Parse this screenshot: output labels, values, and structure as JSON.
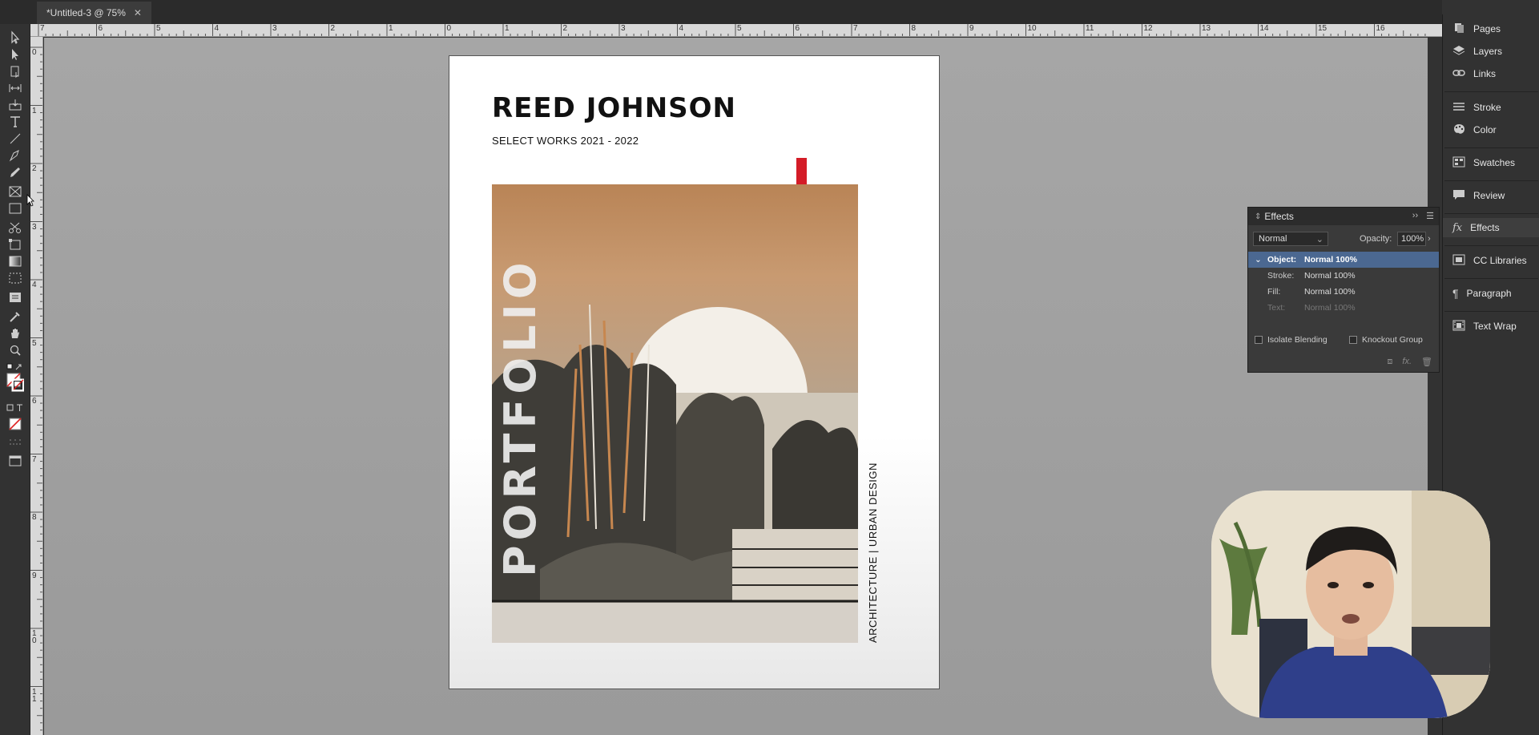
{
  "document_tab": {
    "title": "*Untitled-3 @ 75%",
    "close_glyph": "✕"
  },
  "ruler": {
    "horizontal_ticks": [
      "7",
      "6",
      "5",
      "4",
      "3",
      "2",
      "1",
      "0",
      "1",
      "2",
      "3",
      "4",
      "5",
      "6",
      "7",
      "8",
      "9",
      "10",
      "11",
      "12",
      "13",
      "14",
      "15",
      "16"
    ],
    "vertical_ticks": [
      "0",
      "1",
      "2",
      "3",
      "4",
      "5",
      "6",
      "7",
      "8",
      "9",
      "1\n0",
      "1\n1"
    ]
  },
  "page": {
    "title": "REED JOHNSON",
    "subtitle": "SELECT WORKS 2021 - 2022",
    "cover_word": "PORTFOLIO",
    "side_caption": "ARCHITECTURE | URBAN DESIGN",
    "accent_color": "#d41c27"
  },
  "dock": {
    "items": [
      {
        "label": "Pages",
        "icon": "pages-icon"
      },
      {
        "label": "Layers",
        "icon": "layers-icon"
      },
      {
        "label": "Links",
        "icon": "links-icon"
      },
      {
        "label": "Stroke",
        "icon": "stroke-icon"
      },
      {
        "label": "Color",
        "icon": "color-icon"
      },
      {
        "label": "Swatches",
        "icon": "swatches-icon"
      },
      {
        "label": "Review",
        "icon": "review-icon"
      },
      {
        "label": "Effects",
        "icon": "fx-icon"
      },
      {
        "label": "CC Libraries",
        "icon": "cc-libraries-icon"
      },
      {
        "label": "Paragraph",
        "icon": "paragraph-icon"
      },
      {
        "label": "Text Wrap",
        "icon": "text-wrap-icon"
      }
    ]
  },
  "effects_panel": {
    "title": "Effects",
    "blend_mode": "Normal",
    "opacity_label": "Opacity:",
    "opacity_value": "100%",
    "rows": [
      {
        "key": "Object:",
        "value": "Normal 100%"
      },
      {
        "key": "Stroke:",
        "value": "Normal 100%"
      },
      {
        "key": "Fill:",
        "value": "Normal 100%"
      },
      {
        "key": "Text:",
        "value": "Normal 100%"
      }
    ],
    "isolate_blending": "Isolate Blending",
    "knockout_group": "Knockout Group",
    "selection_color": "#4b6891"
  }
}
